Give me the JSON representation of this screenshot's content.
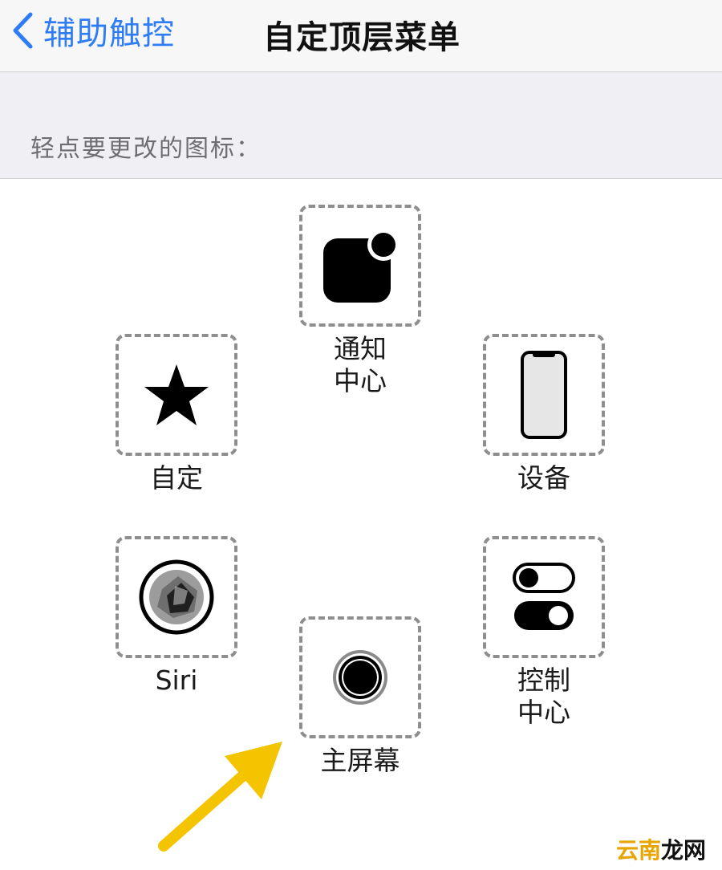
{
  "navbar": {
    "back_label": "辅助触控",
    "title": "自定顶层菜单"
  },
  "section": {
    "header": "轻点要更改的图标："
  },
  "slots": {
    "notification": {
      "label_line1": "通知",
      "label_line2": "中心",
      "icon": "notification-icon"
    },
    "custom": {
      "label": "自定",
      "icon": "star-icon"
    },
    "device": {
      "label": "设备",
      "icon": "iphone-icon"
    },
    "siri": {
      "label": "Siri",
      "icon": "siri-icon"
    },
    "control": {
      "label_line1": "控制",
      "label_line2": "中心",
      "icon": "toggles-icon"
    },
    "home": {
      "label": "主屏幕",
      "icon": "home-button-icon"
    }
  },
  "annotation": {
    "arrow": "arrow-pointer",
    "color": "#f5c400"
  },
  "watermark": {
    "part1": "云南",
    "part2": "龙网"
  },
  "colors": {
    "accent": "#2f7df6",
    "header_bg": "#efeff4"
  }
}
